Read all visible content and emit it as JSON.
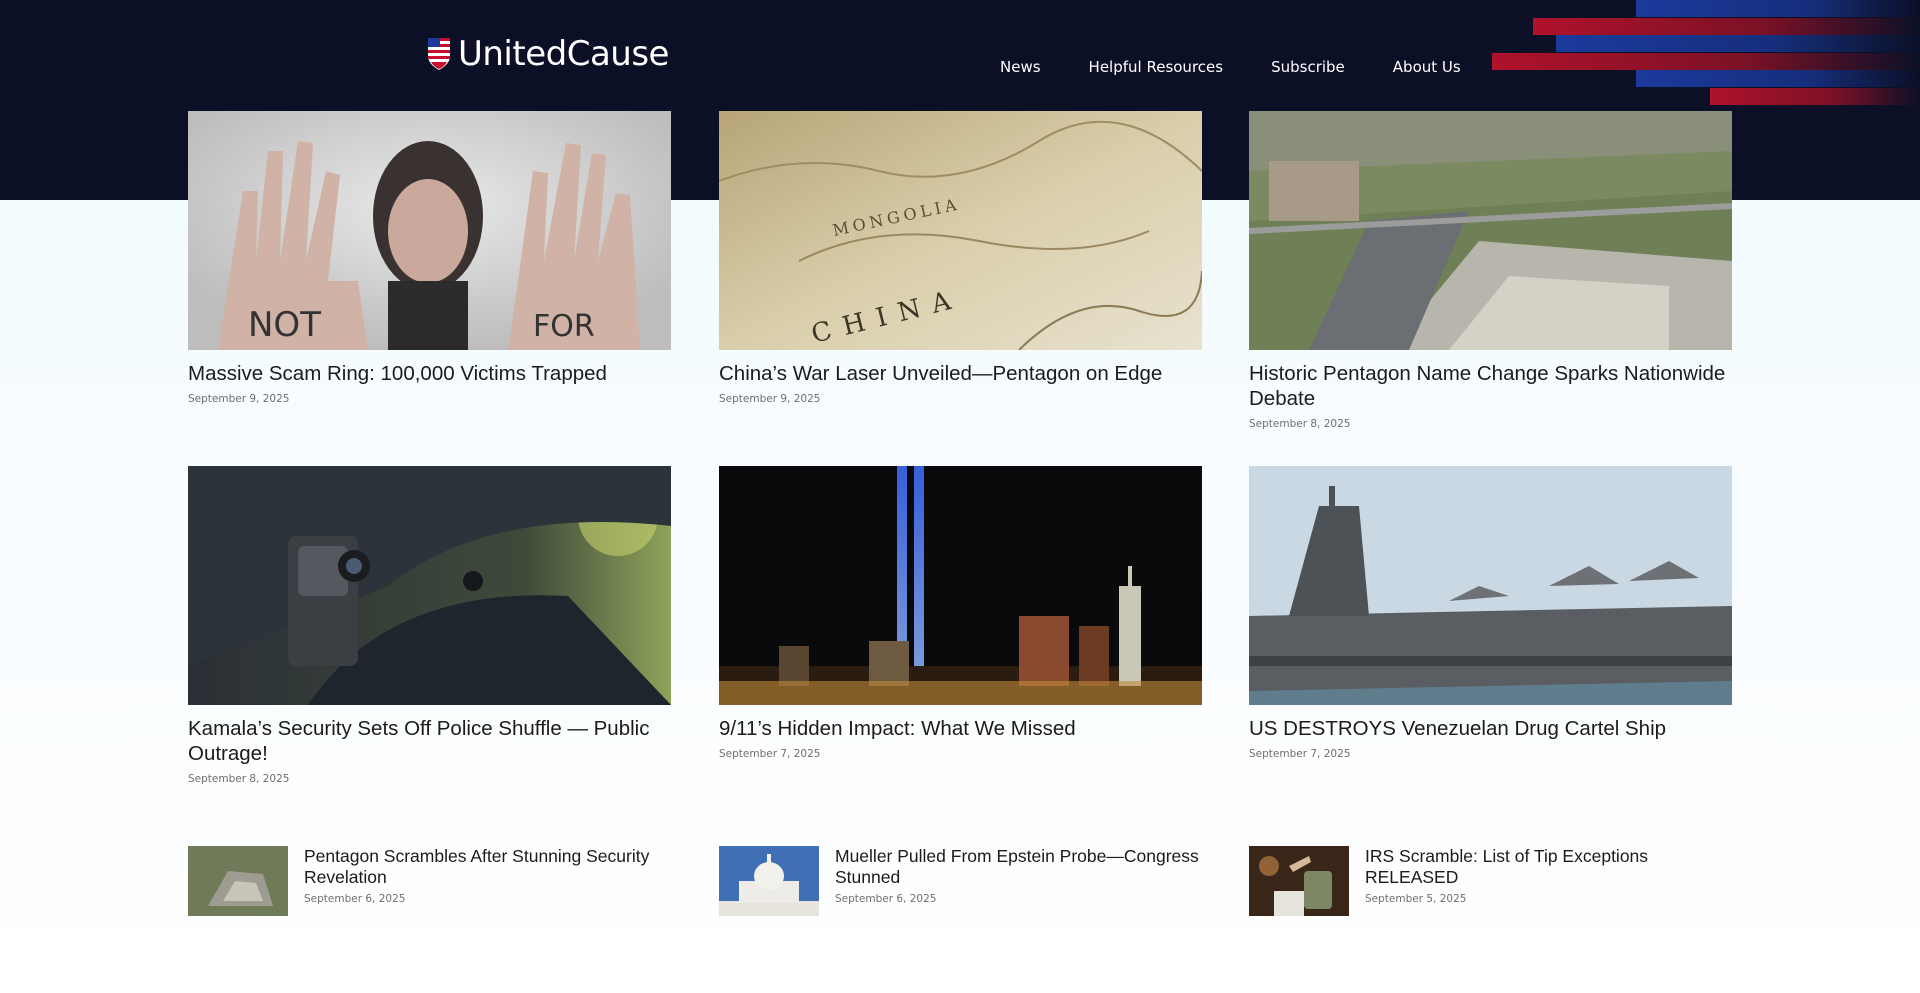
{
  "site": {
    "name": "UnitedCause"
  },
  "nav": [
    {
      "label": "News"
    },
    {
      "label": "Helpful Resources"
    },
    {
      "label": "Subscribe"
    },
    {
      "label": "About Us"
    }
  ],
  "articles": [
    {
      "title": "Massive Scam Ring: 100,000 Victims Trapped",
      "date": "September 9, 2025",
      "image": "woman-hands-not-for-sale"
    },
    {
      "title": "China’s War Laser Unveiled—Pentagon on Edge",
      "date": "September 9, 2025",
      "image": "map-of-china"
    },
    {
      "title": "Historic Pentagon Name Change Sparks Nationwide Debate",
      "date": "September 8, 2025",
      "image": "pentagon-aerial"
    },
    {
      "title": "Kamala’s Security Sets Off Police Shuffle — Public Outrage!",
      "date": "September 8, 2025",
      "image": "police-body-camera"
    },
    {
      "title": "9/11’s Hidden Impact: What We Missed",
      "date": "September 7, 2025",
      "image": "tribute-in-light-skyline"
    },
    {
      "title": "US DESTROYS Venezuelan Drug Cartel Ship",
      "date": "September 7, 2025",
      "image": "aircraft-carrier"
    }
  ],
  "small_articles": [
    {
      "title": "Pentagon Scrambles After Stunning Security Revelation",
      "date": "September 6, 2025",
      "image": "pentagon-aerial-small"
    },
    {
      "title": "Mueller Pulled From Epstein Probe—Congress Stunned",
      "date": "September 6, 2025",
      "image": "capitol-building"
    },
    {
      "title": "IRS Scramble: List of Tip Exceptions RELEASED",
      "date": "September 5, 2025",
      "image": "tip-jar"
    }
  ],
  "colors": {
    "header_bg": "#0b1027",
    "stripe_red": "#b0122a",
    "stripe_blue": "#1b3a9c",
    "text": "#1b1b1b",
    "date_text": "#6f6f6f"
  }
}
